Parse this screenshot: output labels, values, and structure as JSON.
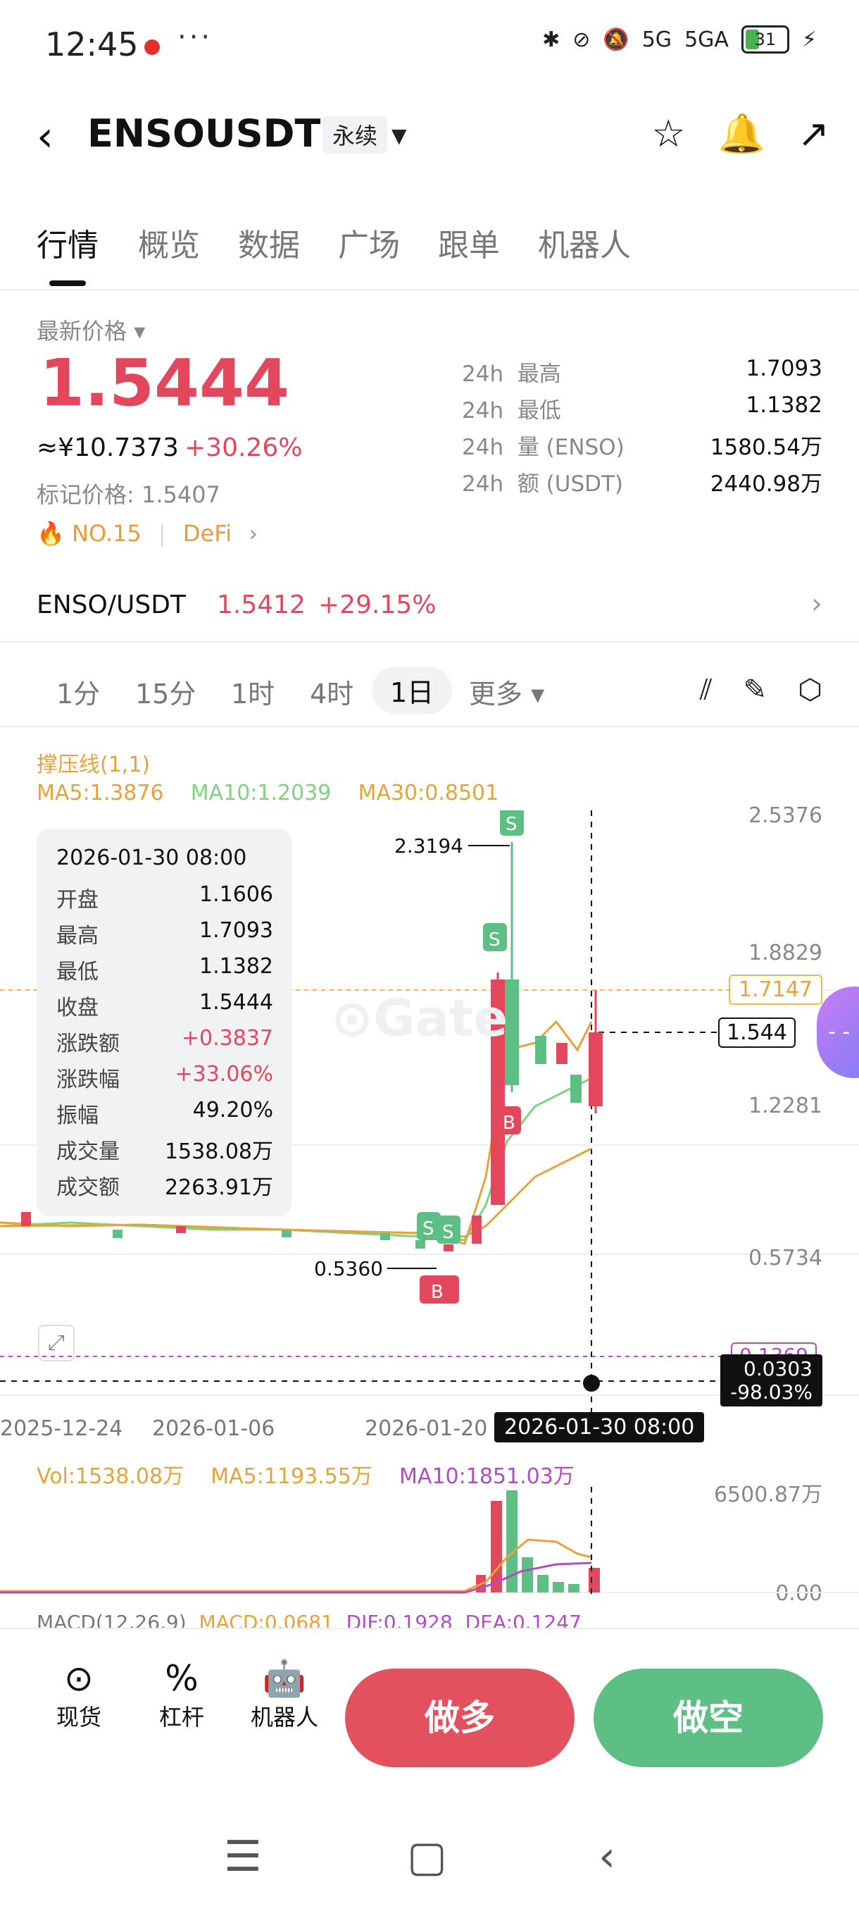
{
  "status_bar": {
    "time": "12:45",
    "dots": "···",
    "network": "5G",
    "network2": "5GA",
    "battery": "31"
  },
  "header": {
    "pair": "ENSOUSDT",
    "contract_type": "永续"
  },
  "tabs": [
    "行情",
    "概览",
    "数据",
    "广场",
    "跟单",
    "机器人"
  ],
  "price": {
    "label": "最新价格",
    "last": "1.5444",
    "cny": "≈¥10.7373",
    "change": "+30.26%",
    "mark_price": "标记价格: 1.5407",
    "rank": "NO.15",
    "sector": "DeFi"
  },
  "stats": [
    {
      "period": "24h",
      "name": "最高",
      "value": "1.7093"
    },
    {
      "period": "24h",
      "name": "最低",
      "value": "1.1382"
    },
    {
      "period": "24h",
      "name": "量 (ENSO)",
      "value": "1580.54万"
    },
    {
      "period": "24h",
      "name": "额 (USDT)",
      "value": "2440.98万"
    }
  ],
  "spot": {
    "pair": "ENSO/USDT",
    "price": "1.5412",
    "change": "+29.15%"
  },
  "intervals": [
    "1分",
    "15分",
    "1时",
    "4时",
    "1日",
    "更多"
  ],
  "indicators": {
    "line1": "撑压线(1,1)",
    "ma5": "MA5:1.3876",
    "ma10": "MA10:1.2039",
    "ma30": "MA30:0.8501"
  },
  "tooltip": {
    "date": "2026-01-30 08:00",
    "rows": [
      {
        "k": "开盘",
        "v": "1.1606"
      },
      {
        "k": "最高",
        "v": "1.7093"
      },
      {
        "k": "最低",
        "v": "1.1382"
      },
      {
        "k": "收盘",
        "v": "1.5444"
      },
      {
        "k": "涨跌额",
        "v": "+0.3837"
      },
      {
        "k": "涨跌幅",
        "v": "+33.06%"
      },
      {
        "k": "振幅",
        "v": "49.20%"
      },
      {
        "k": "成交量",
        "v": "1538.08万"
      },
      {
        "k": "成交额",
        "v": "2263.91万"
      }
    ]
  },
  "chart_data": {
    "type": "candlestick",
    "y_ticks": [
      "2.5376",
      "1.8829",
      "1.2281",
      "0.5734"
    ],
    "x_ticks": [
      "2025-12-24",
      "2026-01-06",
      "2026-01-20"
    ],
    "crosshair_date": "2026-01-30 08:00",
    "crosshair_price": "0.0303",
    "crosshair_pct": "-98.03%",
    "resistance": "1.7147",
    "support": "0.1369",
    "current_price": "1.544",
    "max_label": "2.3194",
    "min_label": "0.5360",
    "markers": [
      "S",
      "S",
      "B",
      "S",
      "S",
      "B"
    ],
    "recent_candles": [
      {
        "open": 0.62,
        "close": 0.66,
        "high": 0.7,
        "low": 0.6
      },
      {
        "open": 0.66,
        "close": 0.64,
        "high": 0.68,
        "low": 0.62
      },
      {
        "open": 0.64,
        "close": 0.78,
        "high": 0.82,
        "low": 0.63
      },
      {
        "open": 0.78,
        "close": 1.8,
        "high": 1.9,
        "low": 0.76
      },
      {
        "open": 1.8,
        "close": 1.2,
        "high": 2.32,
        "low": 1.1
      },
      {
        "open": 1.3,
        "close": 1.45,
        "high": 1.55,
        "low": 1.25
      },
      {
        "open": 1.45,
        "close": 1.35,
        "high": 1.6,
        "low": 1.3
      },
      {
        "open": 1.35,
        "close": 1.2,
        "high": 1.4,
        "low": 1.15
      },
      {
        "open": 1.16,
        "close": 1.54,
        "high": 1.71,
        "low": 1.14
      }
    ]
  },
  "volume": {
    "vol": "Vol:1538.08万",
    "ma5": "MA5:1193.55万",
    "ma10": "MA10:1851.03万",
    "top": "6500.87万",
    "bottom": "0.00"
  },
  "macd": {
    "label": "MACD(12,26,9)",
    "macd": "MACD:0.0681",
    "dif": "DIF:0.1928",
    "dea": "DEA:0.1247"
  },
  "bottom_bar": {
    "spot": "现货",
    "leverage": "杠杆",
    "bot": "机器人",
    "long": "做多",
    "short": "做空"
  },
  "colors": {
    "up": "#e3475b",
    "down": "#5dbf84",
    "ma5": "#e6a33a",
    "ma10": "#7fd27f",
    "ma30": "#e6a33a",
    "accent": "#e89a3c"
  }
}
